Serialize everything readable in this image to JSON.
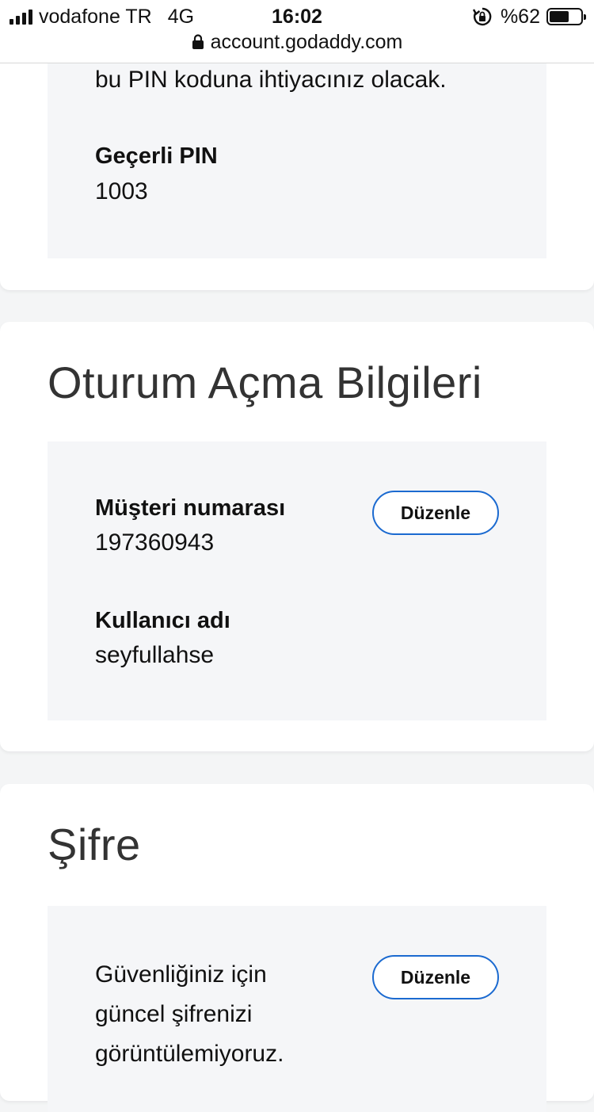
{
  "status_bar": {
    "carrier": "vodafone TR",
    "network": "4G",
    "time": "16:02",
    "battery": "%62",
    "battery_level": 0.62
  },
  "url_bar": {
    "url": "account.godaddy.com"
  },
  "pin_section": {
    "description_tail": "bu PIN koduna ihtiyacınız olacak.",
    "pin_label": "Geçerli PIN",
    "pin_value": "1003"
  },
  "login_section": {
    "title": "Oturum Açma Bilgileri",
    "customer_number_label": "Müşteri numarası",
    "customer_number_value": "197360943",
    "username_label": "Kullanıcı adı",
    "username_value": "seyfullahse",
    "edit_label": "Düzenle"
  },
  "password_section": {
    "title": "Şifre",
    "description_lines": [
      "Güvenliğiniz için",
      "güncel şifrenizi",
      "görüntülemiyoruz."
    ],
    "edit_label": "Düzenle"
  },
  "colors": {
    "button_border": "#1b6ad0",
    "panel_background": "#f5f6f8",
    "page_background": "#f4f5f6"
  }
}
